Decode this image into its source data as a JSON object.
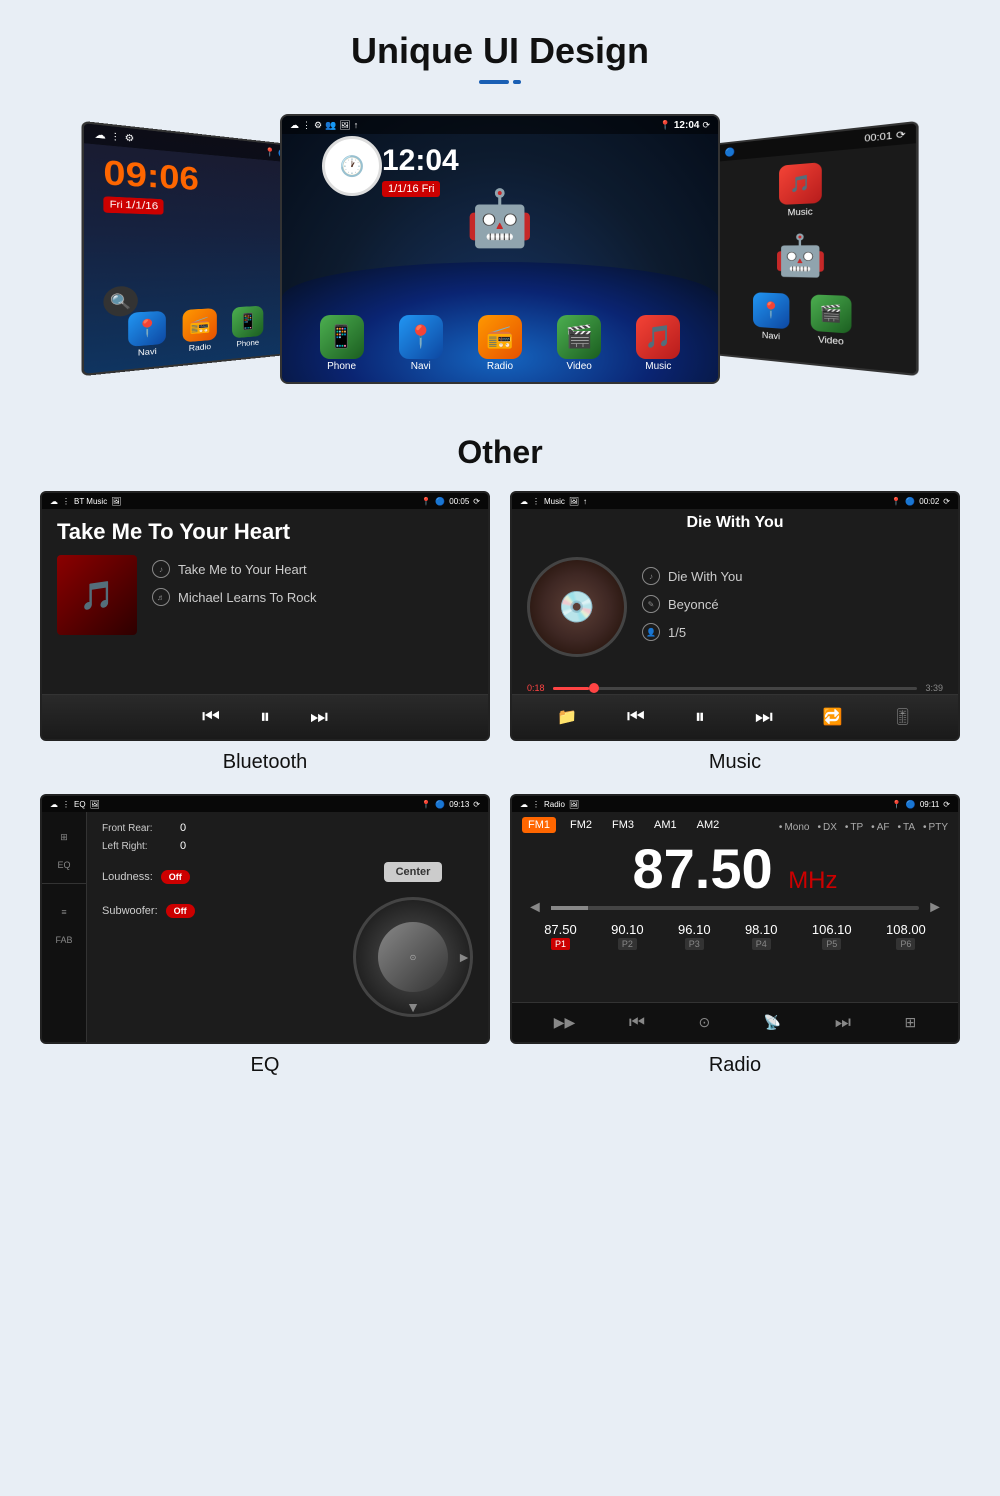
{
  "page": {
    "section1": {
      "title": "Unique UI Design",
      "left_screen": {
        "time": "09:06",
        "date": "Fri 1/1/16",
        "apps": [
          "Navi",
          "Radio",
          "Phone"
        ]
      },
      "center_screen": {
        "time": "12:04",
        "date": "1/1/16 Fri",
        "apps": [
          "Phone",
          "Navi",
          "Radio",
          "Video",
          "Music"
        ]
      },
      "right_screen": {
        "apps": [
          "Music",
          "Navi",
          "Video"
        ]
      }
    },
    "section2": {
      "title": "Other",
      "bt_player": {
        "title": "Take Me To Your Heart",
        "song": "Take Me to Your Heart",
        "artist": "Michael Learns To Rock",
        "label": "Bluetooth",
        "time": "00:05",
        "mode": "BT Music"
      },
      "music_player": {
        "title": "Die With You",
        "song": "Die With You",
        "artist": "Beyoncé",
        "track": "1/5",
        "label": "Music",
        "time": "00:02",
        "progress_start": "0:18",
        "progress_end": "3:39"
      },
      "eq_screen": {
        "label": "EQ",
        "time": "09:13",
        "front_rear": "0",
        "left_right": "0",
        "loudness": "Off",
        "subwoofer": "Off",
        "center_btn": "Center"
      },
      "radio_screen": {
        "label": "Radio",
        "time": "09:11",
        "frequency": "87.50",
        "unit": "MHz",
        "bands": [
          "FM1",
          "FM2",
          "FM3",
          "AM1",
          "AM2"
        ],
        "active_band": "FM1",
        "options": [
          "Mono",
          "DX",
          "TP",
          "AF",
          "TA",
          "PTY"
        ],
        "presets": [
          {
            "freq": "87.50",
            "label": "P1",
            "active": true
          },
          {
            "freq": "90.10",
            "label": "P2",
            "active": false
          },
          {
            "freq": "96.10",
            "label": "P3",
            "active": false
          },
          {
            "freq": "98.10",
            "label": "P4",
            "active": false
          },
          {
            "freq": "106.10",
            "label": "P5",
            "active": false
          },
          {
            "freq": "108.00",
            "label": "P6",
            "active": false
          }
        ]
      }
    }
  }
}
